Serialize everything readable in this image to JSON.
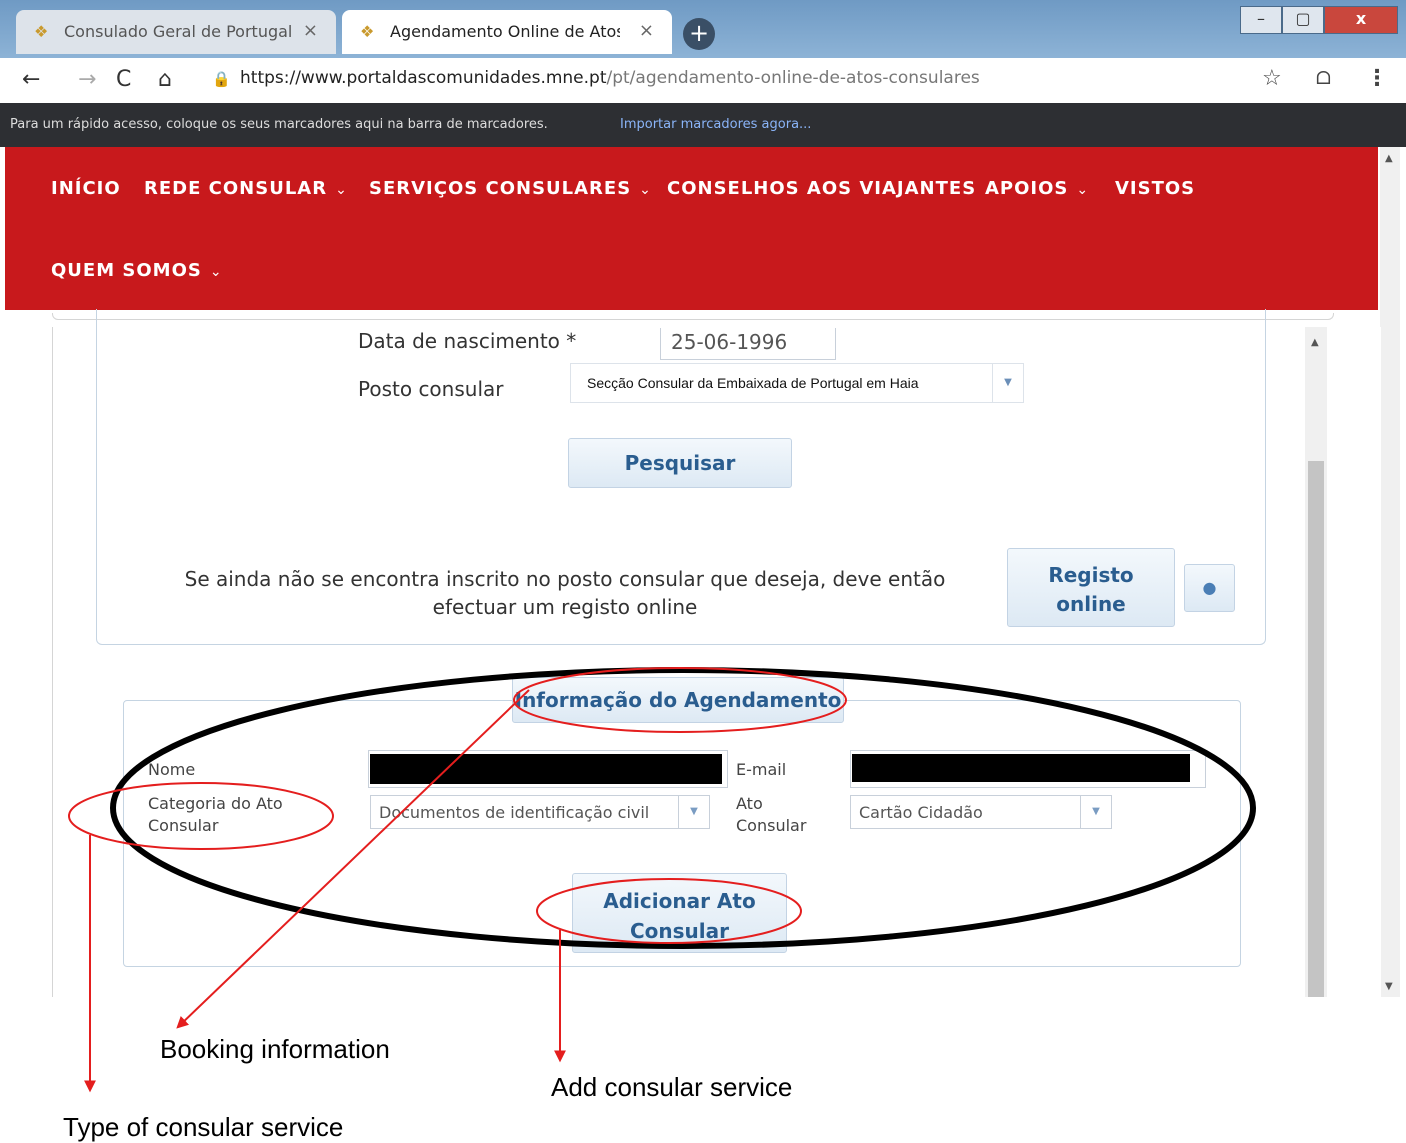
{
  "browser": {
    "tabs": [
      {
        "title": "Consulado Geral de Portugal em",
        "active": false
      },
      {
        "title": "Agendamento Online de Atos Co",
        "active": true
      }
    ],
    "url_domain": "https://www.portaldascomunidades.mne.pt",
    "url_path": "/pt/agendamento-online-de-atos-consulares",
    "bookmarks_text": "Para um rápido acesso, coloque os seus marcadores aqui na barra de marcadores.",
    "bookmarks_link": "Importar marcadores agora..."
  },
  "nav": {
    "inicio": "INÍCIO",
    "rede_consular": "REDE CONSULAR",
    "servicos_consulares": "SERVIÇOS CONSULARES",
    "conselhos": "CONSELHOS AOS VIAJANTES",
    "apoios": "APOIOS",
    "vistos": "VISTOS",
    "quem_somos": "QUEM SOMOS",
    "chevron": "⌄"
  },
  "search_form": {
    "birth_date_label": "Data de nascimento *",
    "birth_date_value": "25-06-1996",
    "post_label": "Posto consular",
    "post_value": "Secção Consular da Embaixada de Portugal em Haia",
    "search_button": "Pesquisar",
    "register_text": "Se ainda não se encontra inscrito no posto consular que deseja, deve então efectuar um registo online",
    "register_button_line1": "Registo",
    "register_button_line2": "online",
    "info_icon": "info-icon"
  },
  "booking": {
    "legend": "Informação do Agendamento",
    "name_label": "Nome",
    "email_label": "E-mail",
    "category_label_line1": "Categoria do Ato",
    "category_label_line2": "Consular",
    "category_value": "Documentos de identificação civil",
    "act_label_line1": "Ato",
    "act_label_line2": "Consular",
    "act_value": "Cartão Cidadão",
    "add_button_line1": "Adicionar Ato",
    "add_button_line2": "Consular"
  },
  "annotations": {
    "booking_information": "Booking information",
    "add_consular_service": "Add consular service",
    "type_of_consular_service": "Type of consular service"
  },
  "colors": {
    "brand_red": "#c8191c",
    "annotation_red": "#e41e1e",
    "button_text": "#2a5d8f"
  }
}
